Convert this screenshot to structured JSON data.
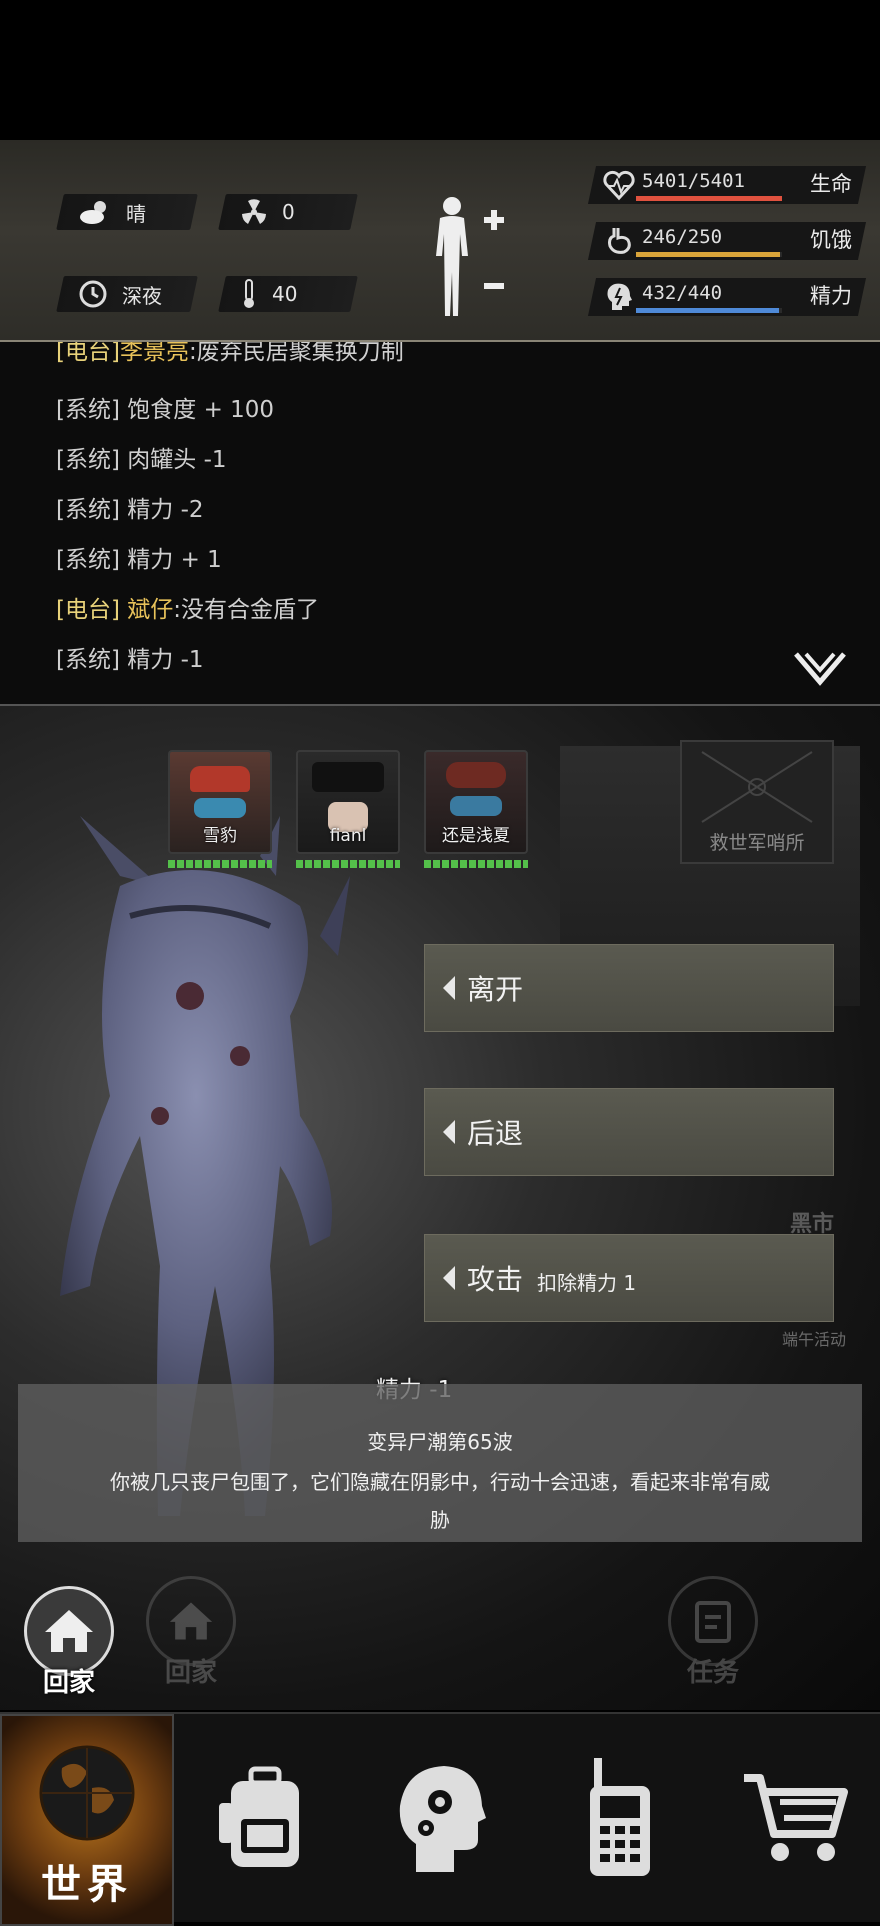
{
  "header": {
    "weather_label": "晴",
    "radiation_value": "0",
    "time_label": "深夜",
    "temperature_value": "40",
    "weather_icon": "cloud-sun-icon",
    "radiation_icon": "radiation-icon",
    "time_icon": "clock-icon",
    "temperature_icon": "thermometer-icon"
  },
  "stats": {
    "life": {
      "value": "5401/5401",
      "label": "生命",
      "fill": 1.0,
      "color": "#e0523f"
    },
    "hunger": {
      "value": "246/250",
      "label": "饥饿",
      "fill": 0.984,
      "color": "#d9a43a"
    },
    "energy": {
      "value": "432/440",
      "label": "精力",
      "fill": 0.982,
      "color": "#4f8ad8"
    }
  },
  "chat": {
    "messages": [
      {
        "tag": "[电台]",
        "speaker": "李景亮",
        "text": ":废弃民居聚集换刀制"
      },
      {
        "tag": "[系统]",
        "speaker": "",
        "text": "饱食度 + 100"
      },
      {
        "tag": "[系统]",
        "speaker": "",
        "text": "肉罐头 -1"
      },
      {
        "tag": "[系统]",
        "speaker": "",
        "text": "精力 -2"
      },
      {
        "tag": "[系统]",
        "speaker": "",
        "text": "精力 + 1"
      },
      {
        "tag": "[电台]",
        "speaker": "斌仔",
        "text": ":没有合金盾了"
      },
      {
        "tag": "[系统]",
        "speaker": "",
        "text": "精力 -1"
      }
    ]
  },
  "party": [
    {
      "name": "雪豹",
      "hp": 1.0
    },
    {
      "name": "fianl",
      "hp": 1.0
    },
    {
      "name": "还是浅夏",
      "hp": 1.0
    }
  ],
  "scene": {
    "background_sign": "救世军哨所",
    "black_market": "黑市",
    "activity": "端午活动"
  },
  "actions": {
    "leave": "离开",
    "retreat": "后退",
    "attack": "攻击",
    "attack_cost": "扣除精力 1"
  },
  "event": {
    "energy_change": "精力 -1",
    "title": "变异尸潮第65波",
    "desc_line1": "你被几只丧尸包围了，它们隐藏在阴影中，行动十会迅速，看起来非常有威",
    "desc_line2": "胁"
  },
  "shortcuts": {
    "home_active": "回家",
    "home_ghost": "回家",
    "task": "任务"
  },
  "nav": {
    "world": "世界",
    "items": [
      "world-globe-icon",
      "backpack-icon",
      "skills-head-icon",
      "walkie-talkie-icon",
      "shopping-cart-icon"
    ]
  }
}
